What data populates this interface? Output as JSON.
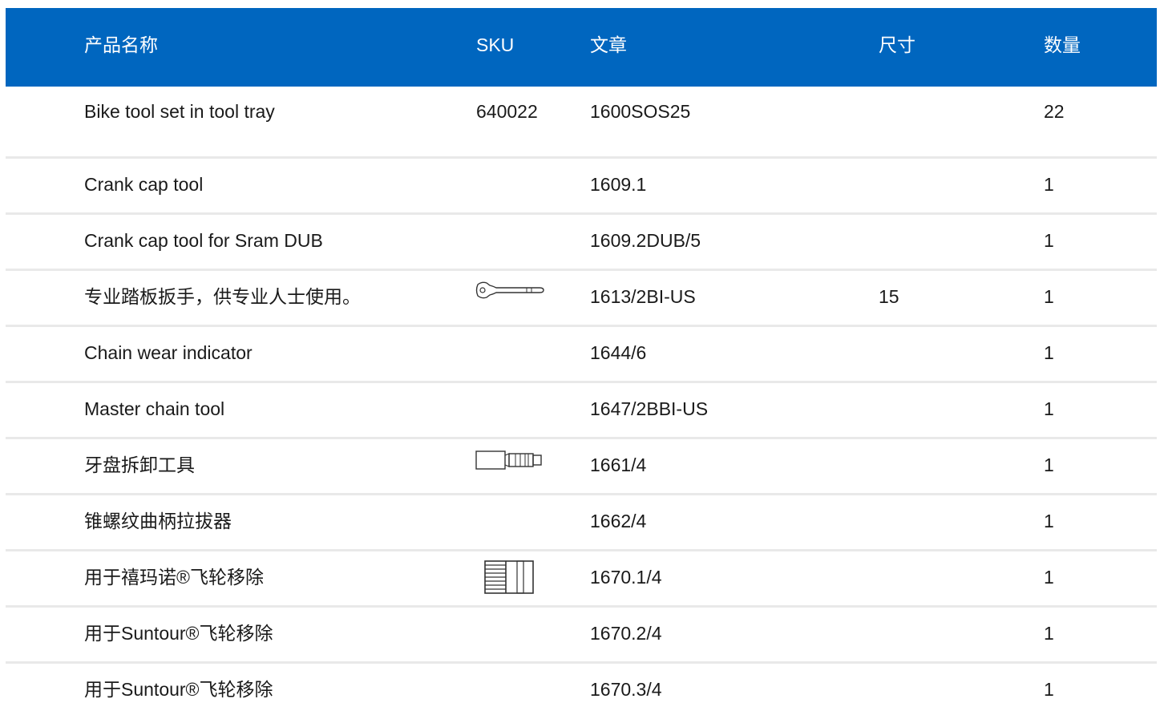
{
  "header": {
    "name": "产品名称",
    "sku": "SKU",
    "article": "文章",
    "size": "尺寸",
    "quantity": "数量"
  },
  "rows": [
    {
      "name": "Bike tool set in tool tray",
      "sku": "640022",
      "article": "1600SOS25",
      "size": "",
      "quantity": "22",
      "icon": ""
    },
    {
      "name": "Crank cap tool",
      "sku": "",
      "article": "1609.1",
      "size": "",
      "quantity": "1",
      "icon": ""
    },
    {
      "name": "Crank cap tool for Sram DUB",
      "sku": "",
      "article": "1609.2DUB/5",
      "size": "",
      "quantity": "1",
      "icon": ""
    },
    {
      "name": "专业踏板扳手，供专业人士使用。",
      "sku": "",
      "article": "1613/2BI-US",
      "size": "15",
      "quantity": "1",
      "icon": "pedal-wrench-icon"
    },
    {
      "name": "Chain wear indicator",
      "sku": "",
      "article": "1644/6",
      "size": "",
      "quantity": "1",
      "icon": ""
    },
    {
      "name": "Master chain tool",
      "sku": "",
      "article": "1647/2BBI-US",
      "size": "",
      "quantity": "1",
      "icon": ""
    },
    {
      "name": "牙盘拆卸工具",
      "sku": "",
      "article": "1661/4",
      "size": "",
      "quantity": "1",
      "icon": "chainring-tool-icon"
    },
    {
      "name": "锥螺纹曲柄拉拔器",
      "sku": "",
      "article": "1662/4",
      "size": "",
      "quantity": "1",
      "icon": ""
    },
    {
      "name": "用于禧玛诺®飞轮移除",
      "sku": "",
      "article": "1670.1/4",
      "size": "",
      "quantity": "1",
      "icon": "freewheel-remover-icon"
    },
    {
      "name": "用于Suntour®飞轮移除",
      "sku": "",
      "article": "1670.2/4",
      "size": "",
      "quantity": "1",
      "icon": ""
    },
    {
      "name": "用于Suntour®飞轮移除",
      "sku": "",
      "article": "1670.3/4",
      "size": "",
      "quantity": "1",
      "icon": ""
    }
  ],
  "colors": {
    "header_background": "#0066bf",
    "header_text": "#ffffff",
    "row_divider": "#e9e9e9"
  }
}
